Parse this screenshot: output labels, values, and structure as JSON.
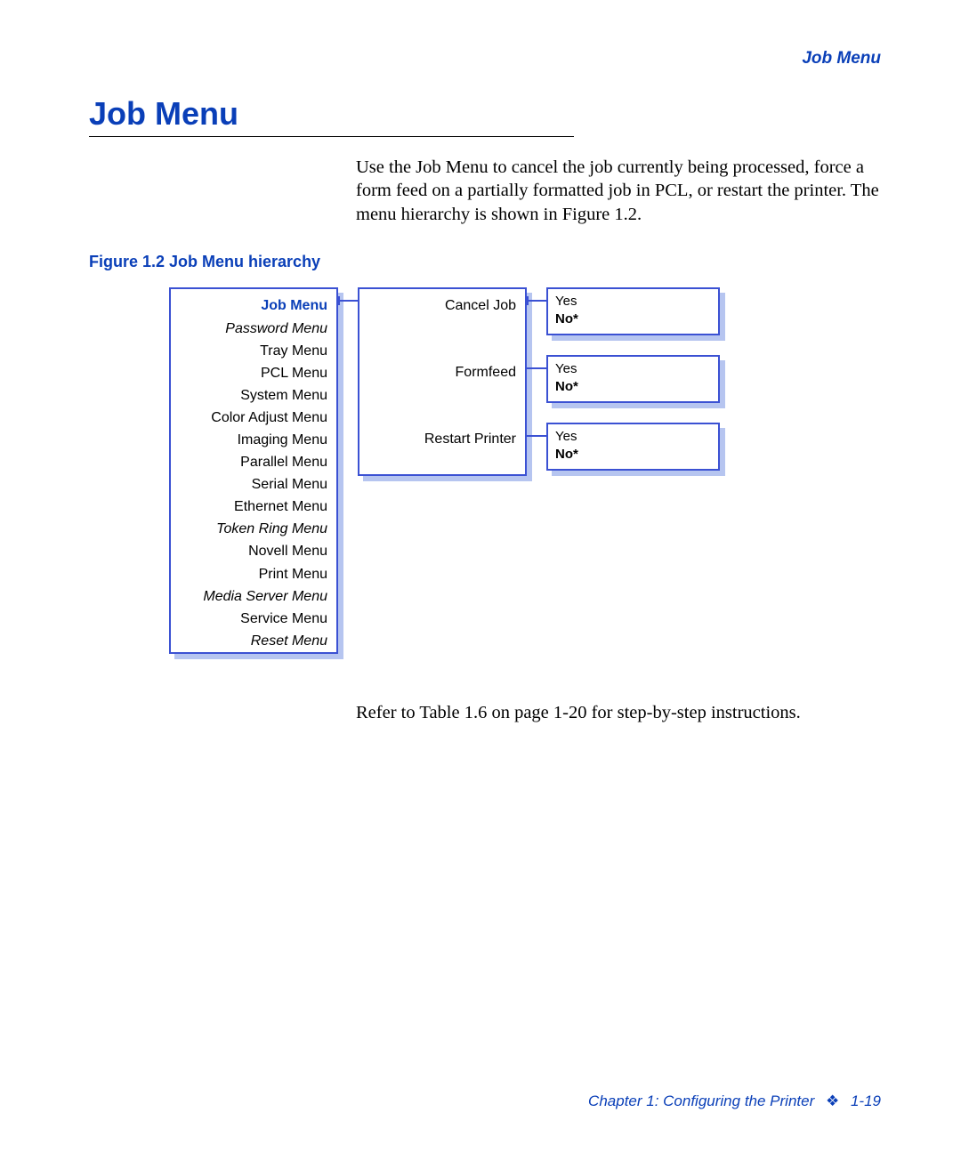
{
  "header": {
    "running_title": "Job Menu"
  },
  "section": {
    "title": "Job Menu",
    "intro": "Use the Job Menu to cancel the job currently being processed, force a form feed on a partially formatted job in PCL, or restart the printer. The menu hierarchy is shown in Figure 1.2.",
    "figure_caption": "Figure 1.2  Job Menu hierarchy",
    "outro": "Refer to Table 1.6 on page 1-20 for step-by-step instructions."
  },
  "menus": {
    "items": [
      {
        "label": "Job Menu",
        "style": "active"
      },
      {
        "label": "Password Menu",
        "style": "italic"
      },
      {
        "label": "Tray Menu",
        "style": ""
      },
      {
        "label": "PCL Menu",
        "style": ""
      },
      {
        "label": "System Menu",
        "style": ""
      },
      {
        "label": "Color Adjust Menu",
        "style": ""
      },
      {
        "label": "Imaging Menu",
        "style": ""
      },
      {
        "label": "Parallel Menu",
        "style": ""
      },
      {
        "label": "Serial Menu",
        "style": ""
      },
      {
        "label": "Ethernet Menu",
        "style": ""
      },
      {
        "label": "Token Ring Menu",
        "style": "italic"
      },
      {
        "label": "Novell Menu",
        "style": ""
      },
      {
        "label": "Print Menu",
        "style": ""
      },
      {
        "label": "Media Server Menu",
        "style": "italic"
      },
      {
        "label": "Service Menu",
        "style": ""
      },
      {
        "label": "Reset Menu",
        "style": "italic"
      }
    ]
  },
  "submenu": {
    "items": [
      {
        "label": "Cancel Job"
      },
      {
        "label": "Formfeed"
      },
      {
        "label": "Restart Printer"
      }
    ]
  },
  "options": {
    "yes": "Yes",
    "no_default": "No*"
  },
  "footer": {
    "chapter": "Chapter 1: Configuring the Printer",
    "bullet": "❖",
    "page": "1-19"
  }
}
